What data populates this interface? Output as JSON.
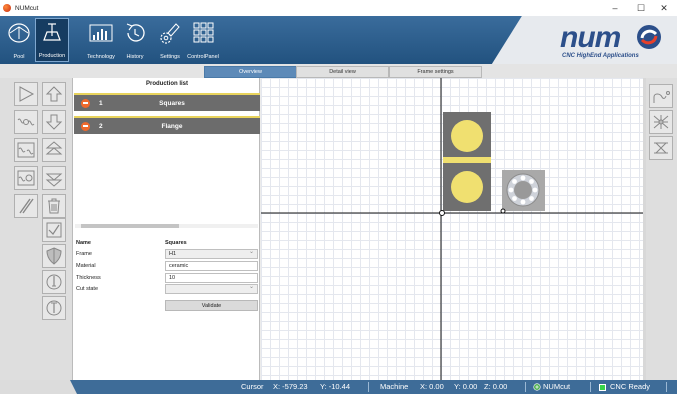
{
  "window": {
    "title": "NUMcut",
    "minimize": "–",
    "maximize": "☐",
    "close": "✕"
  },
  "ribbon": {
    "buttons": [
      {
        "label": "Pool",
        "icon": "pool-icon"
      },
      {
        "label": "Production",
        "icon": "production-icon",
        "selected": true
      },
      {
        "label": "Technology",
        "icon": "technology-icon"
      },
      {
        "label": "History",
        "icon": "history-icon"
      },
      {
        "label": "Settings",
        "icon": "settings-icon"
      },
      {
        "label": "ControlPanel",
        "icon": "control-panel-icon"
      }
    ],
    "logo_word": "num",
    "logo_sub": "CNC HighEnd Applications"
  },
  "tabs": [
    {
      "label": "Overview",
      "active": true
    },
    {
      "label": "Detail view",
      "active": false
    },
    {
      "label": "Frame settings",
      "active": false
    }
  ],
  "production_list": {
    "title": "Production list",
    "items": [
      {
        "number": "1",
        "name": "Squares"
      },
      {
        "number": "2",
        "name": "Flange"
      }
    ]
  },
  "properties": {
    "name_label": "Name",
    "name_value": "Squares",
    "frame_label": "Frame",
    "frame_value": "H1",
    "material_label": "Material",
    "material_value": "ceramic",
    "thickness_label": "Thickness",
    "thickness_value": "10",
    "cut_state_label": "Cut state",
    "cut_state_value": "",
    "validate_label": "Validate"
  },
  "status": {
    "cursor_label": "Cursor",
    "cursor_x": "X: -579.23",
    "cursor_y": "Y: -10.44",
    "machine_label": "Machine",
    "machine_x": "X: 0.00",
    "machine_y": "Y: 0.00",
    "machine_z": "Z: 0.00",
    "app_name": "NUMcut",
    "cnc_state": "CNC Ready"
  },
  "colors": {
    "ribbon": "#2f5f8f",
    "accent_tab": "#5d8ab8",
    "part_fill": "#f0e070",
    "part_plate": "#6f6f6f",
    "flange_plate": "#aaaaaa",
    "status_bar": "#3e6c98",
    "cnc_ready_led": "#39d64a"
  }
}
